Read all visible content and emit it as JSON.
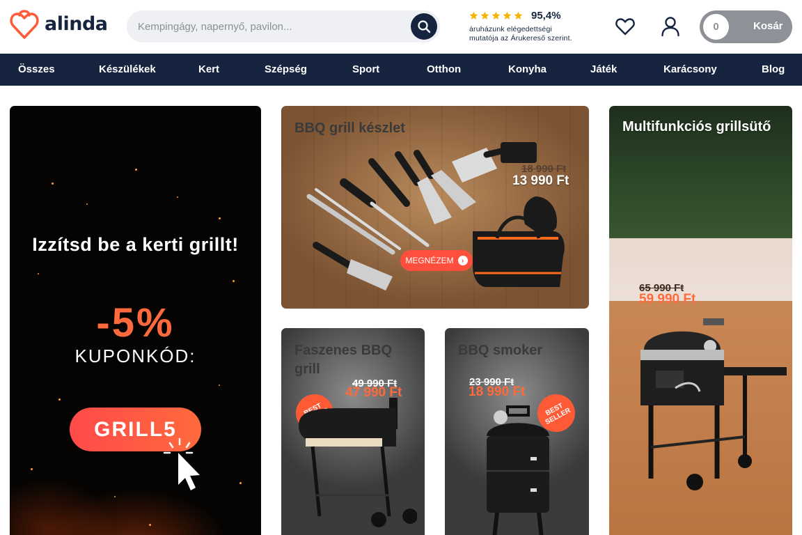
{
  "brand": {
    "name": "alinda"
  },
  "search": {
    "placeholder": "Kempingágy, napernyő, pavilon..."
  },
  "rating": {
    "value": "95,4%",
    "text_line1": "áruházunk elégedettségi",
    "text_line2": "mutatója az Árukereső szerint."
  },
  "cart": {
    "count": "0",
    "label": "Kosár"
  },
  "nav": [
    {
      "label": "Összes"
    },
    {
      "label": "Készülékek"
    },
    {
      "label": "Kert"
    },
    {
      "label": "Szépség"
    },
    {
      "label": "Sport"
    },
    {
      "label": "Otthon"
    },
    {
      "label": "Konyha"
    },
    {
      "label": "Játék"
    },
    {
      "label": "Karácsony"
    },
    {
      "label": "Blog"
    }
  ],
  "banners": {
    "coupon": {
      "headline": "Izzítsd be a kerti grillt!",
      "discount": "-5%",
      "label": "KUPONKÓD:",
      "code": "GRILL5"
    },
    "bbq_set": {
      "title": "BBQ grill készlet",
      "old_price": "18 990 Ft",
      "new_price": "13 990 Ft",
      "cta": "MEGNÉZEM"
    },
    "faszenes": {
      "title_line1": "Faszenes BBQ",
      "title_line2": "grill",
      "old_price": "49 990 Ft",
      "new_price": "47 990 Ft",
      "badge_line1": "BEST",
      "badge_line2": "SELLER"
    },
    "smoker": {
      "title": "BBQ smoker",
      "old_price": "23 990 Ft",
      "new_price": "18 990 Ft",
      "badge_line1": "BEST",
      "badge_line2": "SELLER"
    },
    "multi": {
      "title": "Multifunkciós grillsütő",
      "old_price": "65 990 Ft",
      "new_price": "59 990 Ft"
    }
  },
  "colors": {
    "navy": "#16243f",
    "accent": "#ff5a36",
    "cart_bg": "#8e9197",
    "star": "#f5b400"
  }
}
